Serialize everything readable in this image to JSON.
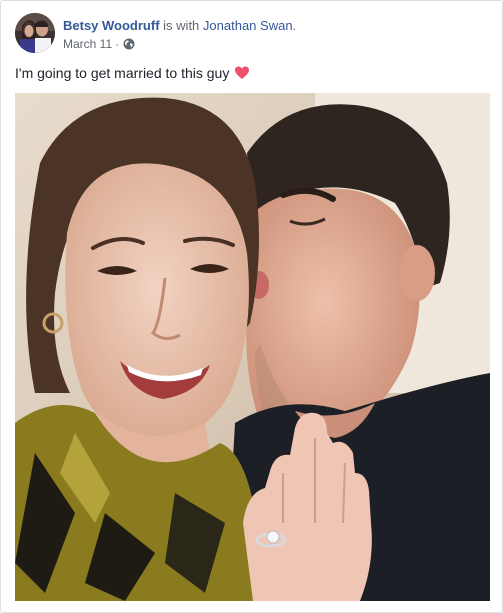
{
  "post": {
    "author": "Betsy Woodruff",
    "with_text": "is with",
    "with_person": "Jonathan Swan",
    "period": ".",
    "date": "March 11",
    "dot": "·",
    "caption": "I'm going to get married to this guy",
    "privacy_icon": "globe-icon",
    "emoji_icon": "heart-icon",
    "heart_color": "#f0506e",
    "link_color": "#365899"
  }
}
